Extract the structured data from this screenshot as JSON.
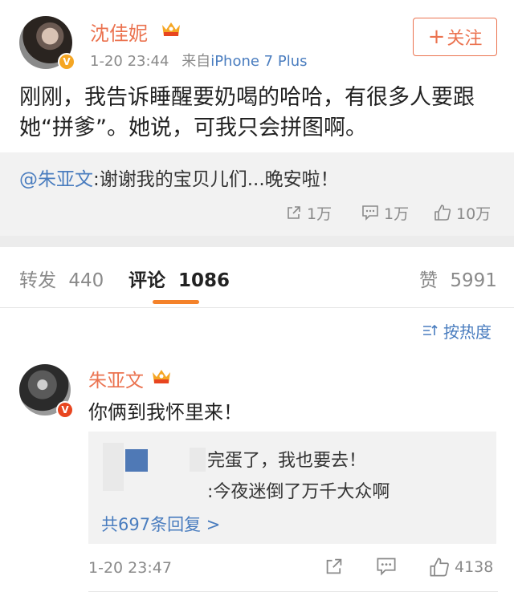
{
  "post": {
    "author": "沈佳妮",
    "time": "1-20 23:44",
    "source_prefix": "来自",
    "source": "iPhone 7 Plus",
    "follow_label": "关注",
    "text": "刚刚，我告诉睡醒要奶喝的哈哈，有很多人要跟她“拼爹”。她说，可我只会拼图啊。"
  },
  "repost": {
    "mention": "@朱亚文",
    "text": ":谢谢我的宝贝儿们...晚安啦！",
    "stats": {
      "share": "1万",
      "comment": "1万",
      "like": "10万"
    }
  },
  "tabs": [
    {
      "label": "转发",
      "count": "440"
    },
    {
      "label": "评论",
      "count": "1086"
    },
    {
      "label": "赞",
      "count": "5991"
    }
  ],
  "sort": {
    "label": "按热度"
  },
  "comment": {
    "author": "朱亚文",
    "text": "你俩到我怀里来！",
    "replies": [
      "完蛋了，我也要去！",
      ":今夜迷倒了万千大众啊"
    ],
    "more_replies": "共697条回复 >",
    "time": "1-20 23:47",
    "like_count": "4138"
  },
  "colors": {
    "accent_orange": "#eb7350",
    "link_blue": "#4a7dbf",
    "tab_underline": "#f4822a",
    "gray_text": "#8a8a8a"
  }
}
